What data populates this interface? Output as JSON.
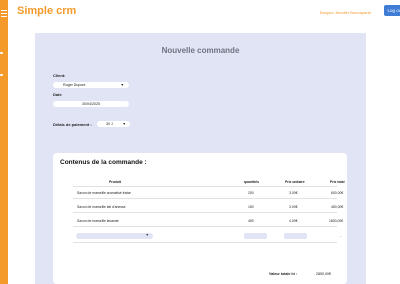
{
  "app": {
    "brand": "Simple crm",
    "welcome": "Bonjour Jennifer Bonnaparte",
    "logout_label": "Log out",
    "colors": {
      "accent": "#f39a2a",
      "button": "#3f7cd6",
      "panel": "#e0e4f4"
    }
  },
  "sidebar": {
    "icon": "menu-icon"
  },
  "form": {
    "title": "Nouvelle commande",
    "client_label": "Client:",
    "client_value": "Roger Dupont",
    "date_label": "Date",
    "date_value": "30/04/2025",
    "payment_label": "Délais de paiement :",
    "payment_value": "30 J"
  },
  "contents": {
    "title": "Contenus de la commande :",
    "headers": {
      "product": "Produit",
      "qty": "quantités",
      "unit_price": "Prix unitaire",
      "total_price": "Prix total"
    },
    "rows": [
      {
        "product": "Savon de marseille aromatisé fraise",
        "qty": "200",
        "unit_price": "3.00€",
        "total": "600,00€"
      },
      {
        "product": "Savon de marseille lait d'anesse",
        "qty": "150",
        "unit_price": "3.00€",
        "total": "450,00€"
      },
      {
        "product": "Savon de marseille lavande",
        "qty": "450",
        "unit_price": "4.00€",
        "total": "1800,00€"
      }
    ],
    "new_row_total": "-",
    "total_label": "Valeur totale ht :",
    "total_value": "2850,00€"
  }
}
